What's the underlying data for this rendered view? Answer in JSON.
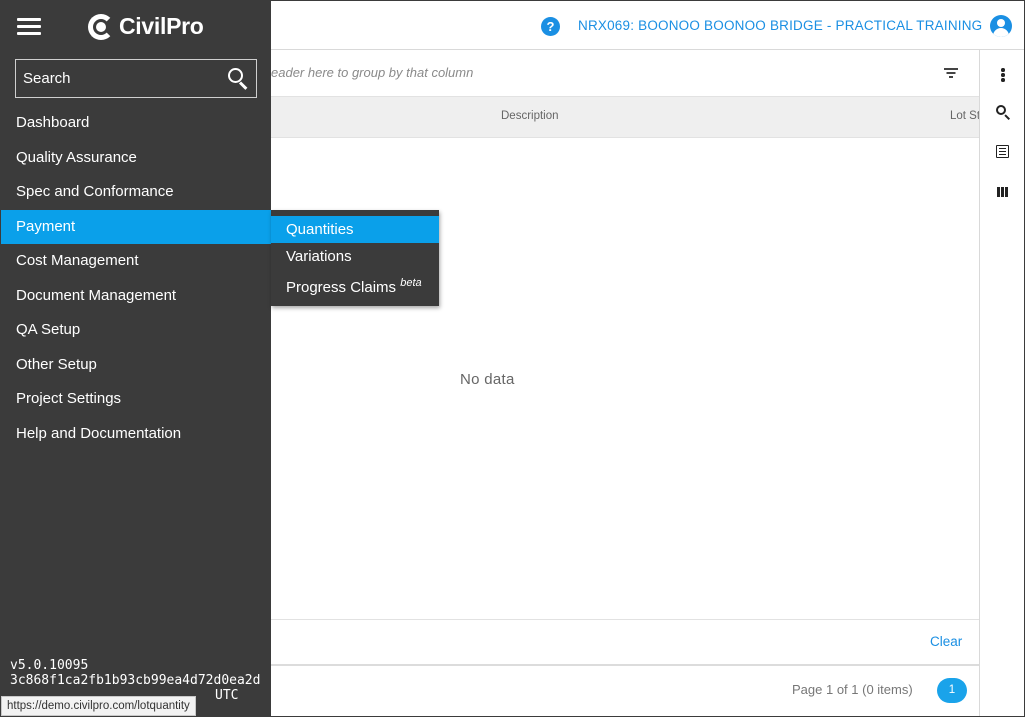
{
  "header": {
    "project_title": "NRX069: BOONOO BOONOO BRIDGE - PRACTICAL TRAINING",
    "help_symbol": "?",
    "user_icon": "user-account-icon"
  },
  "sidebar": {
    "logo_text": "CivilPro",
    "search": {
      "placeholder": "Search",
      "value": ""
    },
    "items": [
      {
        "label": "Dashboard"
      },
      {
        "label": "Quality Assurance"
      },
      {
        "label": "Spec and Conformance"
      },
      {
        "label": "Payment",
        "active": true
      },
      {
        "label": "Cost Management"
      },
      {
        "label": "Document Management"
      },
      {
        "label": "QA Setup"
      },
      {
        "label": "Other Setup"
      },
      {
        "label": "Project Settings"
      },
      {
        "label": "Help and Documentation"
      }
    ],
    "version": {
      "number": "v5.0.10095",
      "commit": "3c868f1ca2fb1b93cb99ea4d72d0ea2d",
      "date_partial": "UTC"
    }
  },
  "submenu": {
    "items": [
      {
        "label": "Quantities",
        "active": true
      },
      {
        "label": "Variations"
      },
      {
        "label": "Progress Claims",
        "badge": "beta"
      }
    ]
  },
  "grid": {
    "group_hint": "eader here to group by that column",
    "columns": [
      "Description",
      "Lot St"
    ],
    "empty_text": "No data",
    "clear_label": "Clear",
    "page_info": "Page 1 of 1 (0 items)",
    "current_page": "1"
  },
  "status_url": "https://demo.civilpro.com/lotquantity",
  "colors": {
    "accent": "#0aa0ea",
    "link": "#1a8fe3",
    "sidebar_bg": "#3b3b3b"
  }
}
